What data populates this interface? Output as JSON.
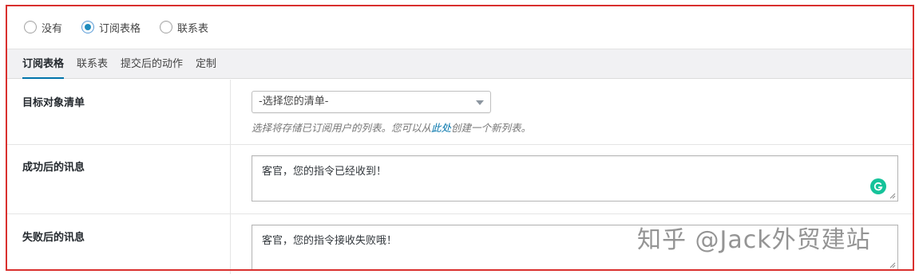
{
  "radio_group": {
    "options": [
      {
        "label": "没有",
        "checked": false
      },
      {
        "label": "订阅表格",
        "checked": true
      },
      {
        "label": "联系表",
        "checked": false
      }
    ]
  },
  "tabs": [
    {
      "label": "订阅表格",
      "active": true
    },
    {
      "label": "联系表",
      "active": false
    },
    {
      "label": "提交后的动作",
      "active": false
    },
    {
      "label": "定制",
      "active": false
    }
  ],
  "fields": {
    "target_list": {
      "label": "目标对象清单",
      "select_value": "-选择您的清单-",
      "hint_before": "选择将存储已订阅用户的列表。您可以从",
      "hint_link": "此处",
      "hint_after": "创建一个新列表。"
    },
    "success_message": {
      "label": "成功后的讯息",
      "value": "客官，您的指令已经收到！"
    },
    "failure_message": {
      "label": "失败后的讯息",
      "value": "客官，您的指令接收失败哦！"
    }
  },
  "watermark": "知乎 @Jack外贸建站",
  "colors": {
    "highlight_border": "#d9302e",
    "accent": "#0073aa",
    "grammarly": "#15c39a"
  }
}
